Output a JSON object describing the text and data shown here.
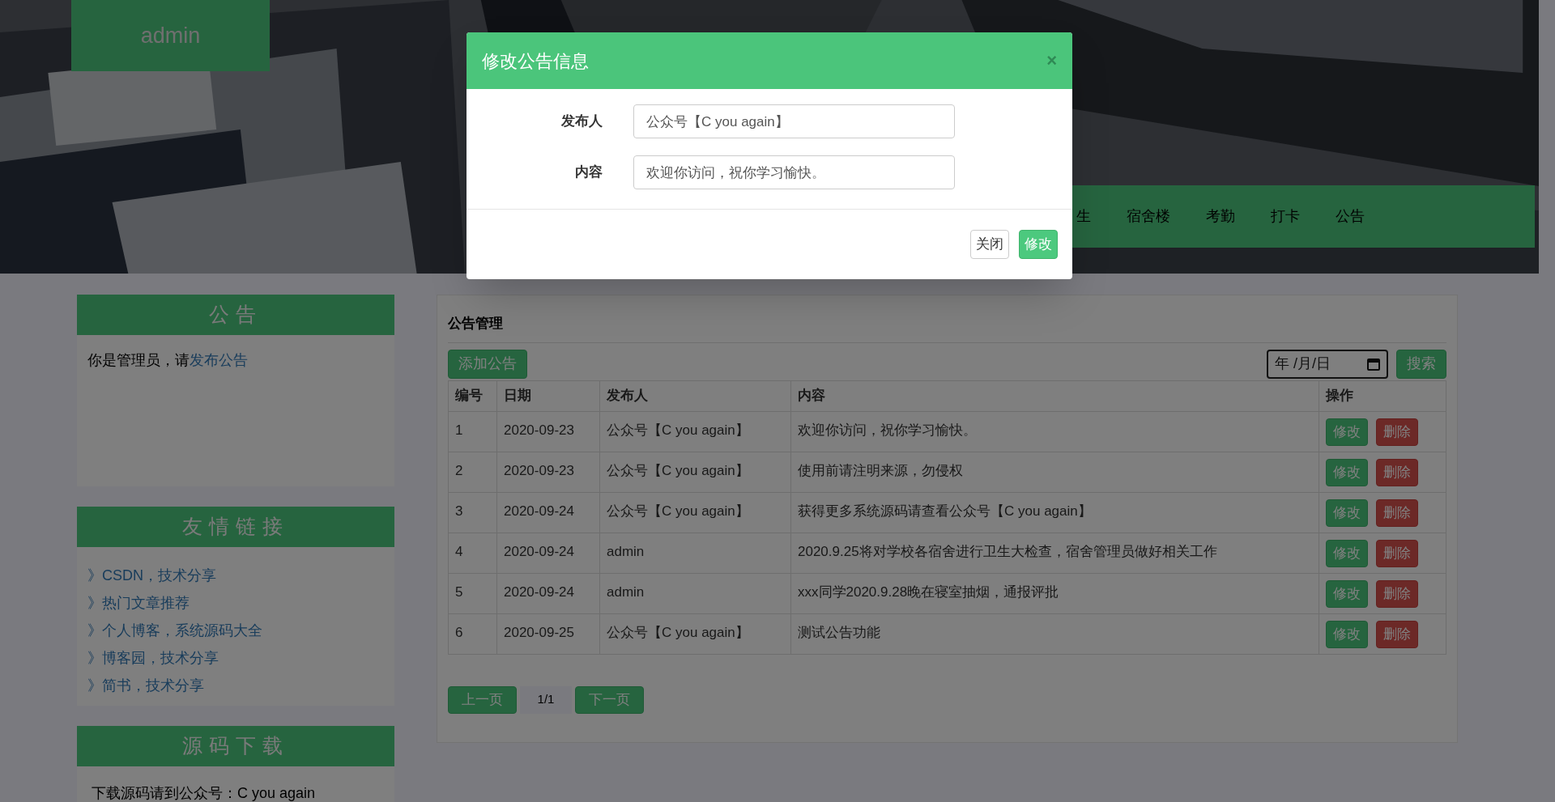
{
  "header": {
    "brand": "admin",
    "nav": [
      {
        "label": "生"
      },
      {
        "label": "宿舍楼"
      },
      {
        "label": "考勤"
      },
      {
        "label": "打卡"
      },
      {
        "label": "公告"
      }
    ]
  },
  "sidebar": [
    {
      "title": "公告",
      "kind": "notice",
      "text": "你是管理员，请",
      "link": "发布公告"
    },
    {
      "title": "友情链接",
      "kind": "links",
      "links": [
        "》CSDN，技术分享",
        "》热门文章推荐",
        "》个人博客，系统源码大全",
        "》博客园，技术分享",
        "》简书，技术分享"
      ]
    },
    {
      "title": "源码下载",
      "kind": "text",
      "text": "下载源码请到公众号：C you again"
    }
  ],
  "main": {
    "title": "公告管理",
    "add_button": "添加公告",
    "date_placeholder": "年 /月/日",
    "search_button": "搜索",
    "table": {
      "columns": [
        "编号",
        "日期",
        "发布人",
        "内容",
        "操作"
      ],
      "rows": [
        {
          "cells": [
            "1",
            "2020-09-23",
            "公众号【C you again】",
            "欢迎你访问，祝你学习愉快。"
          ],
          "actions": [
            "修改",
            "删除"
          ]
        },
        {
          "cells": [
            "2",
            "2020-09-23",
            "公众号【C you again】",
            "使用前请注明来源，勿侵权"
          ],
          "actions": [
            "修改",
            "删除"
          ]
        },
        {
          "cells": [
            "3",
            "2020-09-24",
            "公众号【C you again】",
            "获得更多系统源码请查看公众号【C you again】"
          ],
          "actions": [
            "修改",
            "删除"
          ]
        },
        {
          "cells": [
            "4",
            "2020-09-24",
            "admin",
            "2020.9.25将对学校各宿舍进行卫生大检查，宿舍管理员做好相关工作"
          ],
          "actions": [
            "修改",
            "删除"
          ]
        },
        {
          "cells": [
            "5",
            "2020-09-24",
            "admin",
            "xxx同学2020.9.28晚在寝室抽烟，通报评批"
          ],
          "actions": [
            "修改",
            "删除"
          ]
        },
        {
          "cells": [
            "6",
            "2020-09-25",
            "公众号【C you again】",
            "测试公告功能"
          ],
          "actions": [
            "修改",
            "删除"
          ]
        }
      ]
    },
    "pagination": {
      "prev": "上一页",
      "page": "1/1",
      "next": "下一页"
    }
  },
  "modal": {
    "title": "修改公告信息",
    "close": "×",
    "fields": [
      {
        "label": "发布人",
        "value": "公众号【C you again】"
      },
      {
        "label": "内容",
        "value": "欢迎你访问，祝你学习愉快。"
      }
    ],
    "buttons": [
      {
        "label": "关闭",
        "kind": "default"
      },
      {
        "label": "修改",
        "kind": "primary"
      }
    ]
  }
}
